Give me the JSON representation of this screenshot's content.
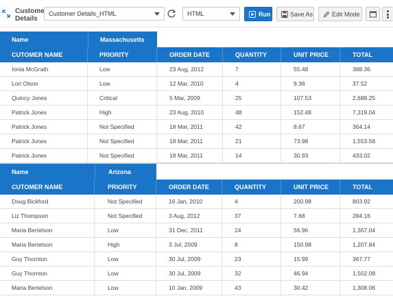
{
  "toolbar": {
    "title": "Customer Details",
    "report_select": "Customer Details_HTML",
    "format_select": "HTML",
    "run_label": "Run",
    "save_as_label": "Save As",
    "edit_mode_label": "Edit Mode"
  },
  "groups": [
    {
      "label": "Name",
      "value": "Massachusetts",
      "columns": [
        "CUTOMER NAME",
        "PRIORITY",
        "ORDER DATE",
        "QUANTITY",
        "UNIT PRICE",
        "TOTAL"
      ],
      "rows": [
        [
          "Ionia McGrath",
          "Low",
          "23 Aug, 2012",
          "7",
          "55.48",
          "388.36"
        ],
        [
          "Lori Olson",
          "Low",
          "12 Mar, 2010",
          "4",
          "9.38",
          "37.52"
        ],
        [
          "Quincy Jones",
          "Critical",
          "5 Mar, 2009",
          "25",
          "107.53",
          "2,688.25"
        ],
        [
          "Patrick Jones",
          "High",
          "23 Aug, 2010",
          "48",
          "152.48",
          "7,319.04"
        ],
        [
          "Patrick Jones",
          "Not Specified",
          "18 Mar, 2011",
          "42",
          "8.67",
          "364.14"
        ],
        [
          "Patrick Jones",
          "Not Specified",
          "18 Mar, 2011",
          "21",
          "73.98",
          "1,553.58"
        ],
        [
          "Patrick Jones",
          "Not Specified",
          "18 Mar, 2011",
          "14",
          "30.93",
          "433.02"
        ]
      ]
    },
    {
      "label": "Name",
      "value": "Arizona",
      "columns": [
        "CUTOMER NAME",
        "PRIORITY",
        "ORDER DATE",
        "QUANTITY",
        "UNIT PRICE",
        "TOTAL"
      ],
      "rows": [
        [
          "Doug Bickford",
          "Not Specified",
          "16 Jan, 2010",
          "4",
          "200.98",
          "803.92"
        ],
        [
          "Liz Thompson",
          "Not Specified",
          "3 Aug, 2012",
          "37",
          "7.68",
          "284.16"
        ],
        [
          "Maria Bertelson",
          "Low",
          "31 Dec, 2011",
          "24",
          "56.96",
          "1,367.04"
        ],
        [
          "Maria Bertelson",
          "High",
          "3 Jul, 2009",
          "8",
          "150.98",
          "1,207.84"
        ],
        [
          "Guy Thornton",
          "Low",
          "30 Jul, 2009",
          "23",
          "15.99",
          "367.77"
        ],
        [
          "Guy Thornton",
          "Low",
          "30 Jul, 2009",
          "32",
          "46.94",
          "1,502.08"
        ],
        [
          "Maria Bertelson",
          "Low",
          "10 Jan, 2009",
          "43",
          "30.42",
          "1,308.06"
        ]
      ]
    }
  ]
}
